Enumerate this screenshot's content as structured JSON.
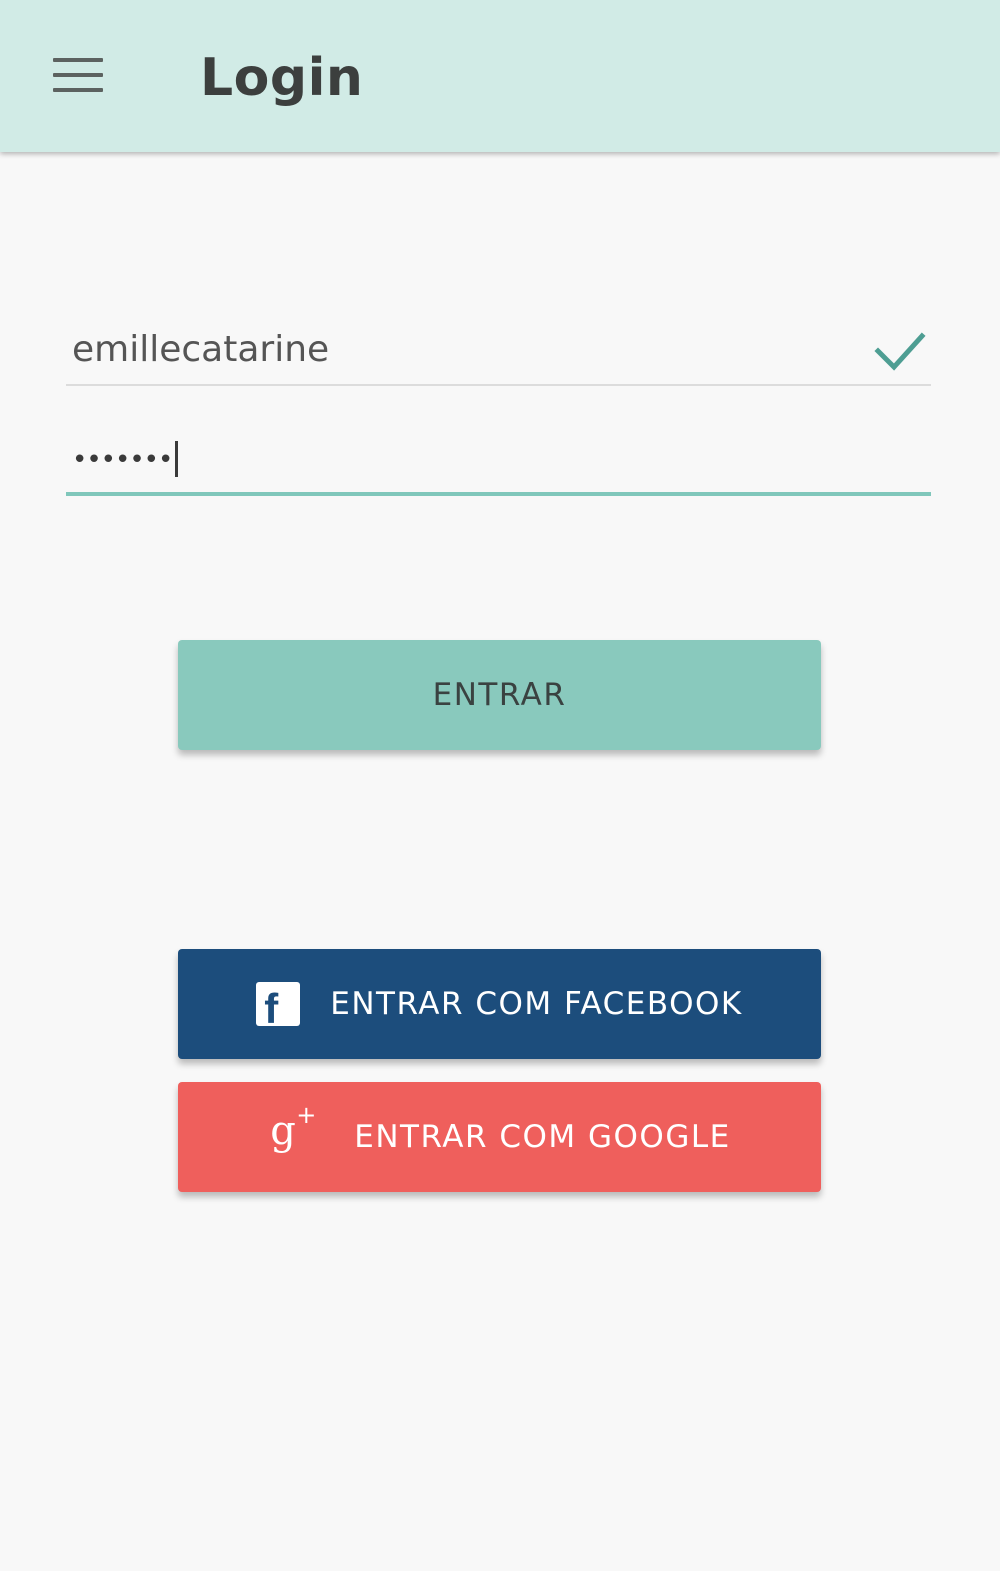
{
  "app_bar": {
    "title": "Login",
    "menu_icon": "hamburger-menu-icon",
    "background": "#d1ebe6"
  },
  "login_form": {
    "username": {
      "value": "emillecatarine",
      "valid": true,
      "status_icon": "checkmark-icon",
      "status_color": "#4e9e93"
    },
    "password": {
      "masked_value": "•••••••",
      "focused": true,
      "underline_color": "#80c7bb"
    },
    "submit_label": "ENTRAR"
  },
  "social_login": {
    "facebook": {
      "label": "ENTRAR COM FACEBOOK",
      "icon": "facebook-icon",
      "icon_glyph": "f",
      "color": "#1c4d7c"
    },
    "google": {
      "label": "ENTRAR COM GOOGLE",
      "icon": "google-plus-icon",
      "icon_glyph_g": "g",
      "icon_glyph_plus": "+",
      "color": "#ef5f5c"
    }
  },
  "colors": {
    "accent": "#89c9bd",
    "background": "#f8f8f8"
  }
}
